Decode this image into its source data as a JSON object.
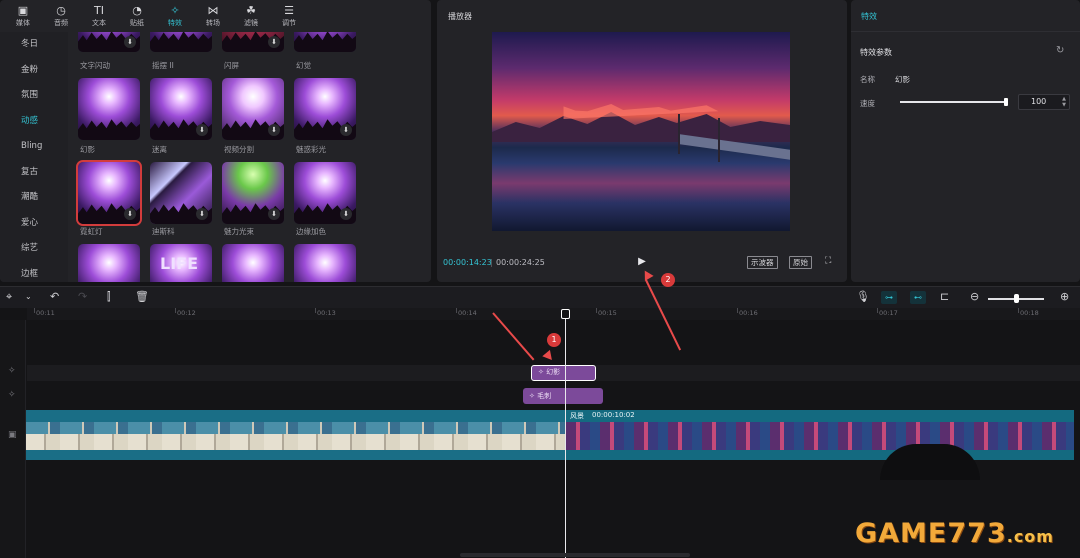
{
  "toolbar": {
    "items": [
      {
        "icon": "▣",
        "label": "媒体"
      },
      {
        "icon": "◷",
        "label": "音频"
      },
      {
        "icon": "TI",
        "label": "文本"
      },
      {
        "icon": "◔",
        "label": "贴纸"
      },
      {
        "icon": "✧",
        "label": "特效"
      },
      {
        "icon": "⋈",
        "label": "转场"
      },
      {
        "icon": "☘",
        "label": "滤镜"
      },
      {
        "icon": "☰",
        "label": "调节"
      }
    ],
    "active": "特效"
  },
  "categories": {
    "items": [
      "冬日",
      "金粉",
      "氛围",
      "动感",
      "Bling",
      "复古",
      "潮酷",
      "爱心",
      "综艺",
      "边框"
    ],
    "active": "动感"
  },
  "effects": {
    "row1_labels": [
      "文字闪动",
      "摇摆 II",
      "闪屏",
      "幻觉"
    ],
    "row2_labels": [
      "幻影",
      "迷离",
      "视频分割",
      "魅惑彩光"
    ],
    "row3_labels": [
      "霓虹灯",
      "迪斯科",
      "魅力光束",
      "边缘加色"
    ],
    "row4_texts": [
      "LIFE"
    ]
  },
  "player": {
    "title": "播放器",
    "time_current": "00:00:14:23",
    "separator": "|",
    "time_total": "00:00:24:25",
    "play_icon": "▶",
    "btn_preview": "示波器",
    "btn_original": "原始",
    "fullscreen_icon": "⛶"
  },
  "inspector": {
    "title": "特效",
    "params_title": "特效参数",
    "reset_icon": "↻",
    "name_label": "名称",
    "name_value": "幻影",
    "speed_label": "速度",
    "speed_value": "100"
  },
  "timeline": {
    "ruler_labels": [
      "00:11",
      "00:12",
      "00:13",
      "00:14",
      "00:15",
      "00:16",
      "00:17",
      "00:18"
    ],
    "effect_clip_1": "幻影",
    "effect_clip_2": "毛刺",
    "video_clip_title": "风景",
    "video_clip_duration": "00:00:10:02"
  },
  "annotations": {
    "marker_1": "1",
    "marker_2": "2"
  },
  "watermark": {
    "main": "GAME773",
    "suffix": ".com"
  },
  "colors": {
    "accent": "#34c4d4",
    "effect_clip": "#7c4a9a",
    "video_clip": "#1a6e86",
    "annotation": "#e84a4a"
  }
}
